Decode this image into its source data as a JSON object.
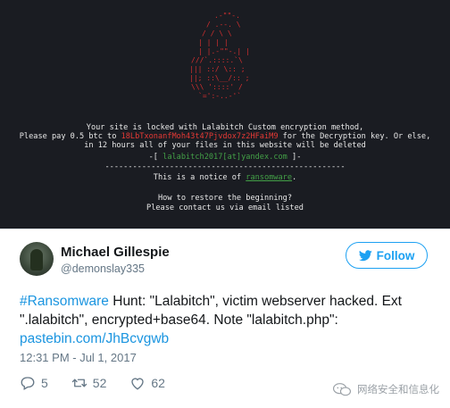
{
  "screenshot": {
    "line1": "Your site is locked with Lalabitch Custom encryption method,",
    "line2_prefix": "Please pay 0.5 btc to ",
    "btc_address": "18LbTxonanfMoh43t47Pjvdox7z2HFaiM9",
    "line2_suffix": " for the Decryption key. Or else,",
    "line3": "in 12 hours all of your files in this website will be deleted",
    "email_prefix": "-[ ",
    "email": "lalabitch2017[at]yandex.com",
    "email_suffix": " ]-",
    "separator": "----------------------------------------------------",
    "notice_prefix": "This is a notice of ",
    "notice_link": "ransomware",
    "notice_suffix": ".",
    "restore_line1": "How to restore the beginning?",
    "restore_line2": "Please contact us via email listed",
    "colors": {
      "background": "#1a1c22",
      "accent_red": "#e53935",
      "accent_green": "#43a047"
    }
  },
  "tweet": {
    "author_name": "Michael Gillespie",
    "author_handle": "@demonslay335",
    "follow_label": "Follow",
    "hashtag": "#Ransomware",
    "body": " Hunt: \"Lalabitch\", victim webserver hacked. Ext \".lalabitch\", encrypted+base64. Note \"lalabitch.php\":",
    "link": "pastebin.com/JhBcvgwb",
    "timestamp": "12:31 PM - Jul 1, 2017",
    "replies": "5",
    "retweets": "52",
    "likes": "62",
    "icons": {
      "reply": "reply-icon",
      "retweet": "retweet-icon",
      "like": "heart-icon",
      "bird": "twitter-bird-icon"
    },
    "accent": "#1da1f2"
  },
  "watermark": {
    "text": "网络安全和信息化"
  }
}
